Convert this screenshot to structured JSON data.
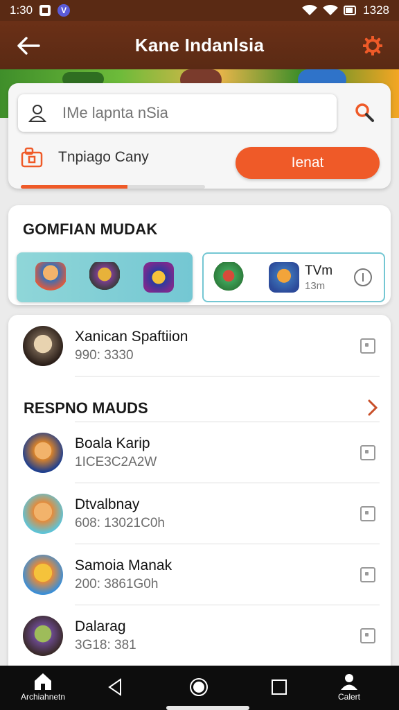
{
  "status_bar": {
    "time": "1:30",
    "clock_right": "1328"
  },
  "app_bar": {
    "title": "Kane Indanlsia"
  },
  "search": {
    "placeholder": "IMe lapnta nSia",
    "category_label": "Tnpiago Cany",
    "cta_label": "Ienat",
    "progress_fraction": 0.58,
    "progress_color": "#ef5a28"
  },
  "featured": {
    "title": "GOMFIAN MUDAK",
    "tile_b": {
      "title": "TVm",
      "subtitle": "13m"
    }
  },
  "top_item": {
    "name": "Xanican Spaftiion",
    "meta": "990: 3330"
  },
  "section": {
    "title": "RESPNO MAUDS"
  },
  "items": [
    {
      "name": "Boala Karip",
      "meta": "1ICE3C2A2W"
    },
    {
      "name": "Dtvalbnay",
      "meta": "608: 13021C0h"
    },
    {
      "name": "Samoia Manak",
      "meta": "200: 3861G0h"
    },
    {
      "name": "Dalarag",
      "meta": "3G18: 381"
    }
  ],
  "bottom_nav": {
    "home_label": "Archiahnetn",
    "profile_label": "Calert"
  },
  "colors": {
    "accent": "#ef5a28",
    "header_bg": "#5a2a14",
    "teal": "#74c7d3"
  },
  "icons": [
    "back-arrow-icon",
    "gear-icon",
    "user-icon",
    "search-icon",
    "category-icon",
    "info-icon",
    "chevron-right-icon",
    "home-icon",
    "back-triangle-icon",
    "home-circle-icon",
    "recents-square-icon",
    "profile-icon"
  ]
}
